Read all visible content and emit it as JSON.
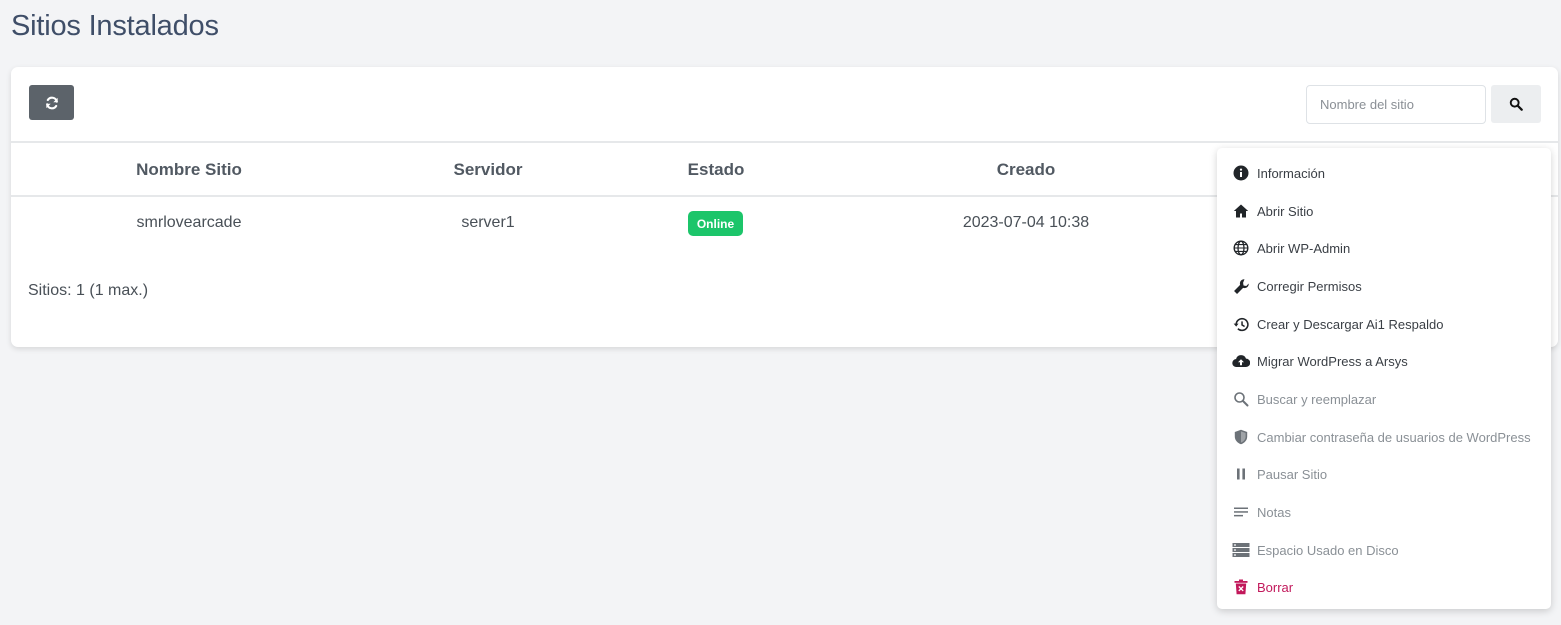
{
  "page": {
    "title": "Sitios Instalados"
  },
  "toolbar": {
    "refresh_icon": "refresh-icon",
    "search_placeholder": "Nombre del sitio",
    "search_value": "",
    "search_icon": "search-icon"
  },
  "table": {
    "headers": [
      "Nombre Sitio",
      "Servidor",
      "Estado",
      "Creado"
    ],
    "rows": [
      {
        "name": "smrlovearcade",
        "server": "server1",
        "status": "Online",
        "created": "2023-07-04 10:38"
      }
    ],
    "status_color": "#1cc56a"
  },
  "footer": {
    "count": "Sitios: 1 (1 max.)"
  },
  "menu": {
    "items": [
      {
        "label": "Información",
        "icon": "info-icon"
      },
      {
        "label": "Abrir Sitio",
        "icon": "home-icon"
      },
      {
        "label": "Abrir WP-Admin",
        "icon": "globe-icon"
      },
      {
        "label": "Corregir Permisos",
        "icon": "wrench-icon"
      },
      {
        "label": "Crear y Descargar Ai1 Respaldo",
        "icon": "history-icon"
      },
      {
        "label": "Migrar WordPress a Arsys",
        "icon": "cloud-upload-icon"
      },
      {
        "label": "Buscar y reemplazar",
        "icon": "search-icon"
      },
      {
        "label": "Cambiar contraseña de usuarios de WordPress",
        "icon": "shield-icon"
      },
      {
        "label": "Pausar Sitio",
        "icon": "pause-icon"
      },
      {
        "label": "Notas",
        "icon": "notes-icon"
      },
      {
        "label": "Espacio Usado en Disco",
        "icon": "storage-icon"
      },
      {
        "label": "Borrar",
        "icon": "trash-icon"
      }
    ],
    "danger_color": "#c2185b"
  }
}
